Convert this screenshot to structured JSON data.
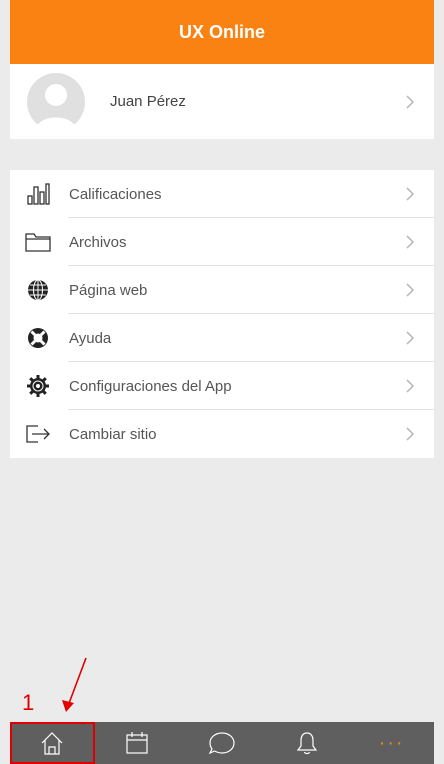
{
  "header": {
    "title": "UX Online"
  },
  "profile": {
    "name": "Juan Pérez"
  },
  "menu": {
    "items": [
      {
        "label": "Calificaciones",
        "icon": "bar-chart-icon"
      },
      {
        "label": "Archivos",
        "icon": "folder-icon"
      },
      {
        "label": "Página web",
        "icon": "globe-icon"
      },
      {
        "label": "Ayuda",
        "icon": "lifebuoy-icon"
      },
      {
        "label": "Configuraciones del App",
        "icon": "gear-icon"
      },
      {
        "label": "Cambiar sitio",
        "icon": "exit-arrow-icon"
      }
    ]
  },
  "annotation": {
    "number": "1"
  },
  "tabbar": {
    "tabs": [
      "home-icon",
      "calendar-icon",
      "chat-bubble-icon",
      "bell-icon",
      "more-dots-icon"
    ],
    "more_label": "···"
  },
  "colors": {
    "accent": "#f98213",
    "tabbar": "#5f5f5f",
    "annotation": "#e00000"
  }
}
